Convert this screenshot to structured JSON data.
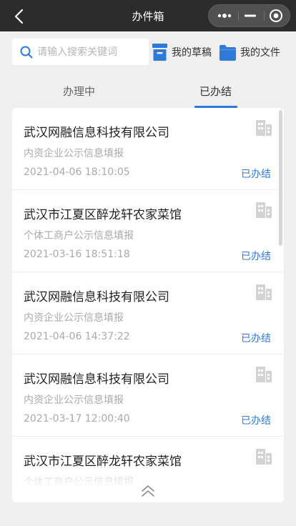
{
  "header": {
    "title": "办件箱"
  },
  "search": {
    "placeholder": "请输入搜索关键词"
  },
  "toolbar": {
    "drafts_label": "我的草稿",
    "files_label": "我的文件"
  },
  "tabs": [
    {
      "label": "办理中",
      "active": false
    },
    {
      "label": "已办结",
      "active": true
    }
  ],
  "colors": {
    "accent": "#2d7ad9",
    "topbar": "#2c2c2c",
    "background": "#efefef"
  },
  "items": [
    {
      "name": "武汉网融信息科技有限公司",
      "type": "内资企业公示信息填报",
      "time": "2021-04-06 18:10:05",
      "status": "已办结",
      "icon": "building-icon"
    },
    {
      "name": "武汉市江夏区醉龙轩农家菜馆",
      "type": "个体工商户公示信息填报",
      "time": "2021-03-16 18:51:18",
      "status": "已办结",
      "icon": "building-icon"
    },
    {
      "name": "武汉网融信息科技有限公司",
      "type": "内资企业公示信息填报",
      "time": "2021-04-06 14:37:22",
      "status": "已办结",
      "icon": "building-icon"
    },
    {
      "name": "武汉网融信息科技有限公司",
      "type": "内资企业公示信息填报",
      "time": "2021-03-17 12:00:40",
      "status": "已办结",
      "icon": "building-icon"
    },
    {
      "name": "武汉市江夏区醉龙轩农家菜馆",
      "type": "个体工商户公示信息填报",
      "icon": "building-icon"
    }
  ]
}
